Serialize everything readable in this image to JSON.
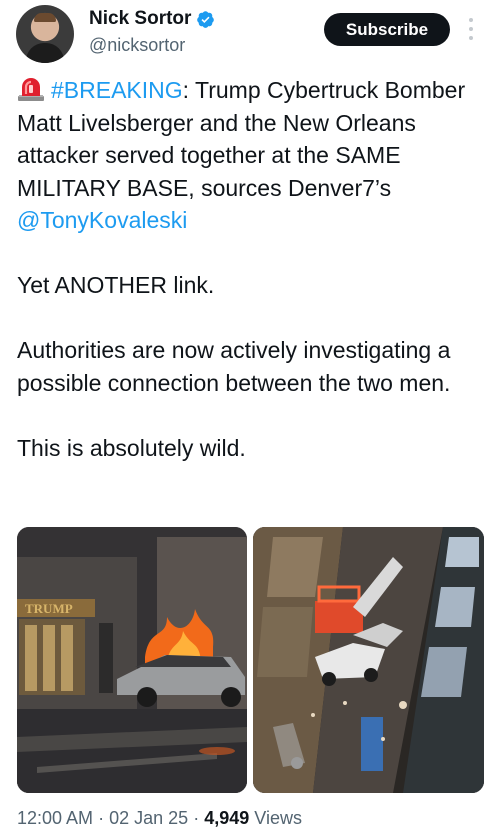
{
  "author": {
    "display_name": "Nick Sortor",
    "handle": "@nicksortor",
    "verified": true
  },
  "actions": {
    "subscribe_label": "Subscribe"
  },
  "tweet": {
    "breaking_tag": "#BREAKING",
    "line1_rest": ": Trump Cybertruck Bomber Matt Livelsberger and the New Orleans attacker served together at the SAME MILITARY BASE, sources Denver7’s ",
    "mention": "@TonyKovaleski",
    "para2": "Yet ANOTHER link.",
    "para3": "Authorities are now actively investigating a possible connection between the two men.",
    "para4": "This is absolutely wild."
  },
  "media": {
    "photo1_sign_text": "TRUMP"
  },
  "meta": {
    "time": "12:00 AM",
    "date": "02 Jan 25",
    "separator": "·",
    "views_count": "4,949",
    "views_label": "Views"
  },
  "colors": {
    "link": "#1d9bf0",
    "text": "#0f1419",
    "secondary": "#536471",
    "verified": "#1d9bf0"
  },
  "icons": {
    "verified": "verified-badge-icon",
    "siren": "siren-emoji-icon",
    "more": "more-vertical-icon"
  }
}
